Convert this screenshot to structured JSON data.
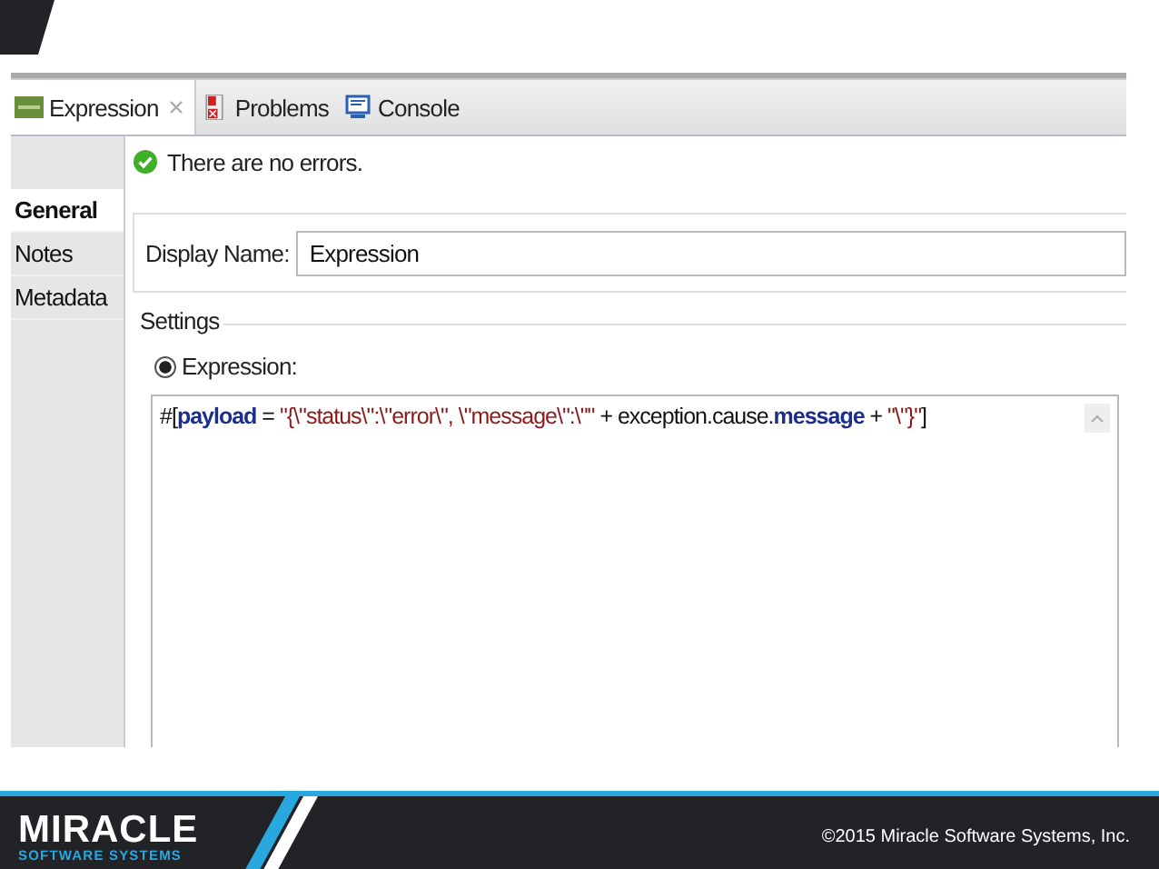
{
  "editor": {
    "tabs": [
      {
        "label": "Expression",
        "kind": "expression",
        "selected": true,
        "closable": true
      },
      {
        "label": "Problems",
        "kind": "problems",
        "selected": false,
        "closable": false
      },
      {
        "label": "Console",
        "kind": "console",
        "selected": false,
        "closable": false
      }
    ],
    "sidebar": {
      "items": [
        {
          "label": "General",
          "selected": true
        },
        {
          "label": "Notes",
          "selected": false
        },
        {
          "label": "Metadata",
          "selected": false
        }
      ]
    },
    "status_message": "There are no errors.",
    "display_name": {
      "label": "Display Name:",
      "value": "Expression"
    },
    "settings": {
      "title": "Settings",
      "option": {
        "label": "Expression:",
        "selected": true
      },
      "code": [
        {
          "kind": "plain",
          "text": "#["
        },
        {
          "kind": "keyword",
          "text": "payload"
        },
        {
          "kind": "plain",
          "text": " = "
        },
        {
          "kind": "string",
          "text": "\"{\\\"status\\\":\\\"error\\\", \\\"message\\\":\\\"\""
        },
        {
          "kind": "plain",
          "text": " + exception.cause."
        },
        {
          "kind": "keyword",
          "text": "message"
        },
        {
          "kind": "plain",
          "text": " + "
        },
        {
          "kind": "string",
          "text": "\"\\\"}\""
        },
        {
          "kind": "plain",
          "text": "]"
        }
      ]
    }
  },
  "footer": {
    "logo": {
      "name": "MIRACLE",
      "tagline": "SOFTWARE SYSTEMS"
    },
    "copyright": "©2015 Miracle Software Systems, Inc."
  }
}
